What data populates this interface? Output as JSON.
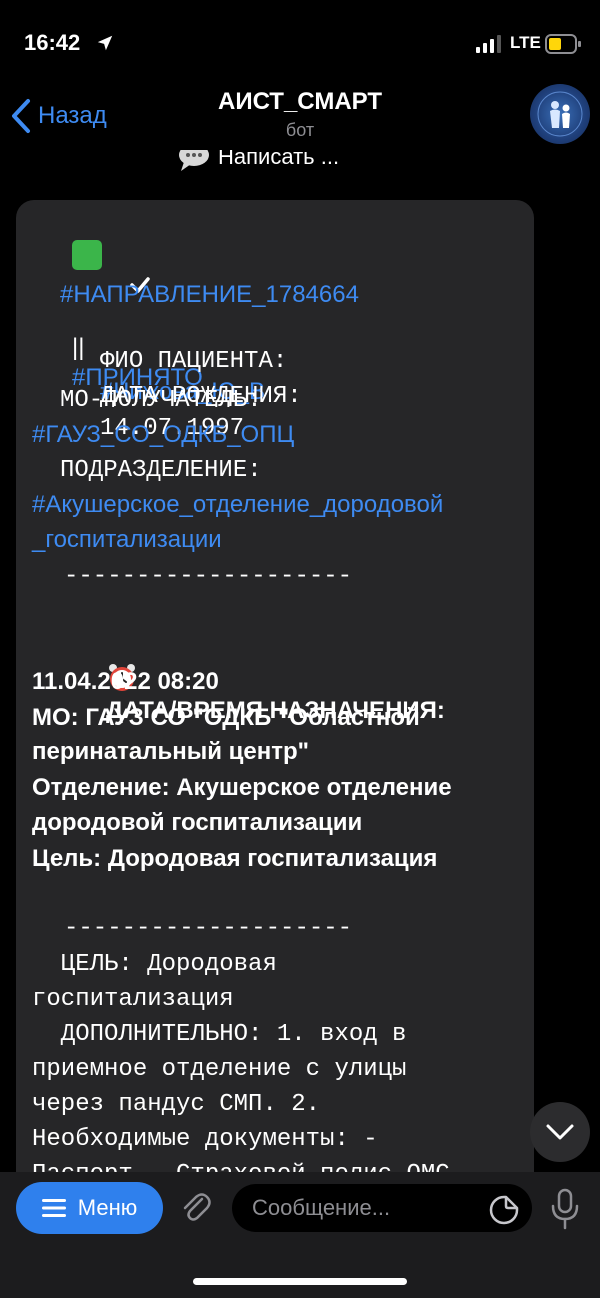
{
  "status_bar": {
    "time": "16:42",
    "network": "LTE",
    "icons": [
      "location-arrow-icon",
      "signal-bars-icon",
      "battery-icon"
    ]
  },
  "header": {
    "back_label": "Назад",
    "title": "АИСТ_СМАРТ",
    "subtitle": "бот"
  },
  "pinned": {
    "write_label": "Написать ..."
  },
  "message": {
    "status_tag": "#ПРИНЯТО",
    "status_separator": "||",
    "direction_tag": "#НАПРАВЛЕНИЕ_1784664",
    "patient_label": "ФИО ПАЦИЕНТА:",
    "patient_value": "#Чижова_Ю_В",
    "birth_label": "ДАТА РОЖДЕНИЯ:",
    "birth_value": "14.07.1997",
    "mo_receiver_label": "МО-ПОЛУЧАТЕЛЬ:",
    "mo_receiver_value": "#ГАУЗ_СО_ОДКБ_ОПЦ",
    "department_label": "ПОДРАЗДЕЛЕНИЕ:",
    "department_value_line1": "#Акушерское_отделение_дородовой",
    "department_value_line2": "_госпитализации",
    "divider": "--------------------",
    "appointment_label": "ДАТА/ВРЕМЯ НАЗНАЧЕНИЯ:",
    "appointment_value": "11.04.2022 08:20",
    "mo_line1": "МО: ГАУЗ СО \"ОДКБ \"Областной",
    "mo_line2": "перинатальный центр\"",
    "dept_line1": "Отделение: Акушерское отделение",
    "dept_line2": "дородовой госпитализации",
    "goal_line": "Цель: Дородовая госпитализация",
    "goal2_line1": "  ЦЕЛЬ: Дородовая",
    "goal2_line2": "госпитализация",
    "extra_line1": "  ДОПОЛНИТЕЛЬНО: 1. вход в",
    "extra_line2": "приемное отделение с улицы",
    "extra_line3": "через пандус СМП. 2.",
    "extra_line4": "Необходимые документы: -",
    "extra_line5": "Паспорт - Страховой полис ОМС"
  },
  "input_bar": {
    "menu_label": "Меню",
    "message_placeholder": "Сообщение..."
  },
  "colors": {
    "accent": "#3e8bf2",
    "menu_button": "#2f80ed",
    "bubble": "#262628",
    "background": "#000000"
  }
}
